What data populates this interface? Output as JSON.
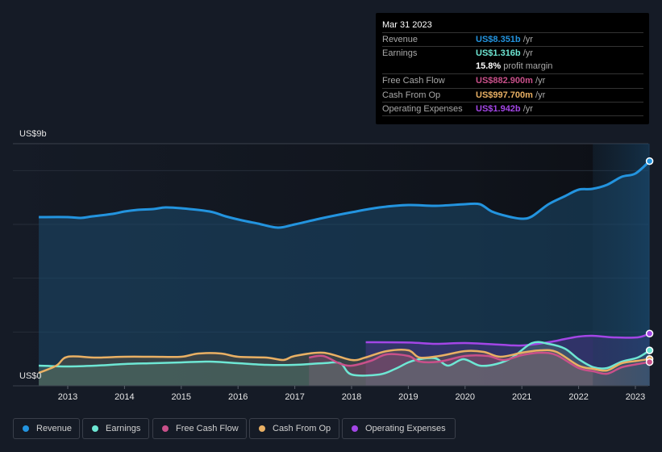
{
  "tooltip": {
    "date": "Mar 31 2023",
    "rows": [
      {
        "label": "Revenue",
        "value": "US$8.351b",
        "unit": " /yr",
        "color": "#2394df"
      },
      {
        "label": "Earnings",
        "value": "US$1.316b",
        "unit": " /yr",
        "color": "#6ee7d4"
      },
      {
        "label": "",
        "value": "15.8%",
        "unit": " profit margin",
        "color": "#ffffff"
      },
      {
        "label": "Free Cash Flow",
        "value": "US$882.900m",
        "unit": " /yr",
        "color": "#c9508a"
      },
      {
        "label": "Cash From Op",
        "value": "US$997.700m",
        "unit": " /yr",
        "color": "#e9b064"
      },
      {
        "label": "Operating Expenses",
        "value": "US$1.942b",
        "unit": " /yr",
        "color": "#a346e6"
      }
    ]
  },
  "legend": [
    {
      "label": "Revenue",
      "color": "#2394df"
    },
    {
      "label": "Earnings",
      "color": "#6ee7d4"
    },
    {
      "label": "Free Cash Flow",
      "color": "#c9508a"
    },
    {
      "label": "Cash From Op",
      "color": "#e9b064"
    },
    {
      "label": "Operating Expenses",
      "color": "#a346e6"
    }
  ],
  "chart_data": {
    "type": "area",
    "title": "",
    "xlabel": "",
    "ylabel": "",
    "y_top_label": "US$9b",
    "y_bottom_label": "US$0",
    "ylim": [
      0,
      9
    ],
    "y_unit": "US$ billions",
    "xlim": [
      2012.5,
      2023.25
    ],
    "x_ticks": [
      2013,
      2014,
      2015,
      2016,
      2017,
      2018,
      2019,
      2020,
      2021,
      2022,
      2023
    ],
    "x_tick_labels": [
      "2013",
      "2014",
      "2015",
      "2016",
      "2017",
      "2018",
      "2019",
      "2020",
      "2021",
      "2022",
      "2023"
    ],
    "gridlines": [
      0,
      2,
      4,
      6,
      8,
      9
    ],
    "highlight_range": [
      2022.25,
      2023.25
    ],
    "legend_position": "bottom",
    "series": [
      {
        "name": "Revenue",
        "color": "#2394df",
        "x": [
          2012.49,
          2013.0,
          2013.23,
          2013.44,
          2013.79,
          2014.0,
          2014.23,
          2014.51,
          2014.72,
          2015.0,
          2015.5,
          2015.78,
          2016.07,
          2016.35,
          2016.7,
          2017.0,
          2017.5,
          2018.0,
          2018.49,
          2019.0,
          2019.48,
          2020.0,
          2020.26,
          2020.47,
          2020.75,
          2021.0,
          2021.18,
          2021.47,
          2021.76,
          2022.0,
          2022.24,
          2022.5,
          2022.76,
          2023.0,
          2023.25
        ],
        "values": [
          6.27,
          6.27,
          6.24,
          6.3,
          6.39,
          6.48,
          6.54,
          6.57,
          6.63,
          6.6,
          6.48,
          6.3,
          6.15,
          6.03,
          5.88,
          6.0,
          6.24,
          6.45,
          6.63,
          6.72,
          6.69,
          6.75,
          6.75,
          6.48,
          6.3,
          6.21,
          6.3,
          6.75,
          7.05,
          7.29,
          7.32,
          7.47,
          7.77,
          7.89,
          8.351
        ]
      },
      {
        "name": "Earnings",
        "color": "#6ee7d4",
        "x": [
          2012.49,
          2013.0,
          2013.5,
          2014.0,
          2014.5,
          2015.0,
          2015.5,
          2016.0,
          2016.5,
          2017.0,
          2017.5,
          2017.8,
          2018.0,
          2018.49,
          2018.77,
          2019.0,
          2019.2,
          2019.48,
          2019.7,
          2019.97,
          2020.26,
          2020.55,
          2020.83,
          2021.18,
          2021.47,
          2021.76,
          2022.0,
          2022.26,
          2022.5,
          2022.76,
          2023.04,
          2023.25
        ],
        "values": [
          0.75,
          0.72,
          0.75,
          0.81,
          0.84,
          0.87,
          0.9,
          0.84,
          0.78,
          0.78,
          0.84,
          0.84,
          0.42,
          0.42,
          0.63,
          0.87,
          0.99,
          1.02,
          0.75,
          0.99,
          0.75,
          0.81,
          1.05,
          1.59,
          1.56,
          1.38,
          0.99,
          0.69,
          0.66,
          0.9,
          1.05,
          1.316
        ]
      },
      {
        "name": "Free Cash Flow",
        "color": "#c9508a",
        "x": [
          2017.25,
          2017.5,
          2017.78,
          2018.0,
          2018.34,
          2018.62,
          2019.0,
          2019.2,
          2019.55,
          2020.0,
          2020.4,
          2020.68,
          2021.0,
          2021.33,
          2021.61,
          2022.0,
          2022.26,
          2022.5,
          2022.76,
          2023.04,
          2023.25
        ],
        "values": [
          1.05,
          1.11,
          0.84,
          0.75,
          0.93,
          1.17,
          1.11,
          0.9,
          0.9,
          1.11,
          1.11,
          0.96,
          1.14,
          1.23,
          1.14,
          0.66,
          0.54,
          0.45,
          0.69,
          0.81,
          0.883
        ]
      },
      {
        "name": "Cash From Op",
        "color": "#e9b064",
        "x": [
          2012.49,
          2012.8,
          2013.0,
          2013.5,
          2014.0,
          2014.5,
          2015.0,
          2015.3,
          2015.7,
          2016.0,
          2016.5,
          2016.8,
          2017.0,
          2017.5,
          2018.0,
          2018.24,
          2018.62,
          2019.0,
          2019.2,
          2019.55,
          2020.0,
          2020.33,
          2020.62,
          2021.0,
          2021.33,
          2021.61,
          2022.0,
          2022.26,
          2022.5,
          2022.76,
          2023.04,
          2023.25
        ],
        "values": [
          0.48,
          0.75,
          1.08,
          1.05,
          1.08,
          1.08,
          1.08,
          1.2,
          1.2,
          1.08,
          1.05,
          0.96,
          1.11,
          1.23,
          0.96,
          1.05,
          1.29,
          1.32,
          1.05,
          1.11,
          1.29,
          1.26,
          1.08,
          1.23,
          1.32,
          1.26,
          0.75,
          0.63,
          0.57,
          0.84,
          0.93,
          0.998
        ]
      },
      {
        "name": "Operating Expenses",
        "color": "#a346e6",
        "x": [
          2018.25,
          2019.0,
          2019.48,
          2020.0,
          2020.61,
          2021.0,
          2021.47,
          2021.76,
          2022.0,
          2022.24,
          2022.61,
          2023.04,
          2023.25
        ],
        "values": [
          1.62,
          1.61,
          1.56,
          1.59,
          1.53,
          1.5,
          1.62,
          1.74,
          1.83,
          1.86,
          1.8,
          1.8,
          1.942
        ]
      }
    ]
  }
}
